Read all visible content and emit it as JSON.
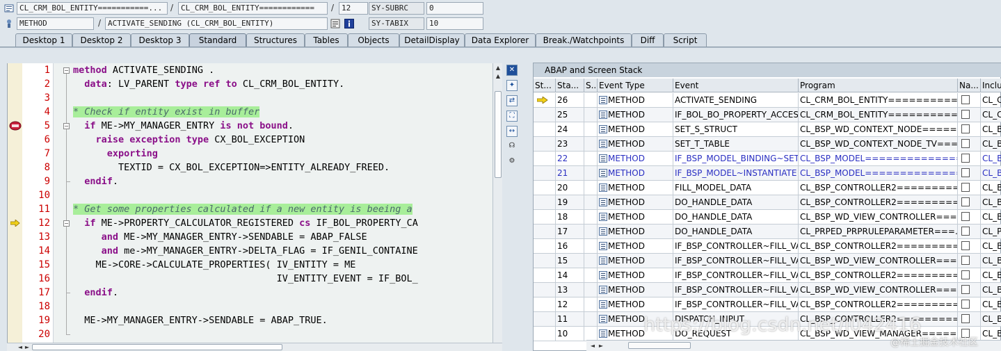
{
  "header": {
    "row1": {
      "class_field": "CL_CRM_BOL_ENTITY===========...",
      "class_field2": "CL_CRM_BOL_ENTITY============",
      "line": "12",
      "sysvar": "SY-SUBRC",
      "sysval": "0"
    },
    "row2": {
      "type_field": "METHOD",
      "name_field": "ACTIVATE_SENDING (CL_CRM_BOL_ENTITY)",
      "sysvar": "SY-TABIX",
      "sysval": "10"
    }
  },
  "tabs": [
    "Desktop 1",
    "Desktop 2",
    "Desktop 3",
    "Standard",
    "Structures",
    "Tables",
    "Objects",
    "DetailDisplay",
    "Data Explorer",
    "Break./Watchpoints",
    "Diff",
    "Script"
  ],
  "active_tab": "Standard",
  "editor": {
    "lines": [
      {
        "n": "1",
        "code": "method ACTIVATE_SENDING ."
      },
      {
        "n": "2",
        "code": "  data: LV_PARENT type ref to CL_CRM_BOL_ENTITY."
      },
      {
        "n": "3",
        "code": ""
      },
      {
        "n": "4",
        "code": "* Check if entity exist in buffer"
      },
      {
        "n": "5",
        "code": "  if ME->MY_MANAGER_ENTRY is not bound."
      },
      {
        "n": "6",
        "code": "    raise exception type CX_BOL_EXCEPTION"
      },
      {
        "n": "7",
        "code": "      exporting"
      },
      {
        "n": "8",
        "code": "        TEXTID = CX_BOL_EXCEPTION=>ENTITY_ALREADY_FREED."
      },
      {
        "n": "9",
        "code": "  endif."
      },
      {
        "n": "10",
        "code": ""
      },
      {
        "n": "11",
        "code": "* Get some properties calculated if a new entity is beeing a"
      },
      {
        "n": "12",
        "code": "  if ME->PROPERTY_CALCULATOR_REGISTERED cs IF_BOL_PROPERTY_CA"
      },
      {
        "n": "13",
        "code": "     and ME->MY_MANAGER_ENTRY->SENDABLE = ABAP_FALSE"
      },
      {
        "n": "14",
        "code": "     and me->MY_MANAGER_ENTRY->DELTA_FLAG = IF_GENIL_CONTAINE"
      },
      {
        "n": "15",
        "code": "    ME->CORE->CALCULATE_PROPERTIES( IV_ENTITY = ME"
      },
      {
        "n": "16",
        "code": "                                    IV_ENTITY_EVENT = IF_BOL_"
      },
      {
        "n": "17",
        "code": "  endif."
      },
      {
        "n": "18",
        "code": ""
      },
      {
        "n": "19",
        "code": "  ME->MY_MANAGER_ENTRY->SENDABLE = ABAP_TRUE."
      },
      {
        "n": "20",
        "code": ""
      }
    ]
  },
  "stack": {
    "title": "ABAP and Screen Stack",
    "columns": [
      "St...",
      "Sta...",
      "S...",
      "Event Type",
      "Event",
      "Program",
      "Na...",
      "Inclu"
    ],
    "rows": [
      {
        "level": "26",
        "type": "METHOD",
        "event": "ACTIVATE_SENDING",
        "program": "CL_CRM_BOL_ENTITY===========...",
        "incl": "CL_C"
      },
      {
        "level": "25",
        "type": "METHOD",
        "event": "IF_BOL_BO_PROPERTY_ACCES...",
        "program": "CL_CRM_BOL_ENTITY===========...",
        "incl": "CL_C"
      },
      {
        "level": "24",
        "type": "METHOD",
        "event": "SET_S_STRUCT",
        "program": "CL_BSP_WD_CONTEXT_NODE=====...",
        "incl": "CL_B"
      },
      {
        "level": "23",
        "type": "METHOD",
        "event": "SET_T_TABLE",
        "program": "CL_BSP_WD_CONTEXT_NODE_TV===...",
        "incl": "CL_B"
      },
      {
        "level": "22",
        "type": "METHOD",
        "event": "IF_BSP_MODEL_BINDING~SET...",
        "program": "CL_BSP_MODEL===============...",
        "incl": "CL_B"
      },
      {
        "level": "21",
        "type": "METHOD",
        "event": "IF_BSP_MODEL~INSTANTIATE",
        "program": "CL_BSP_MODEL===============...",
        "incl": "CL_B"
      },
      {
        "level": "20",
        "type": "METHOD",
        "event": "FILL_MODEL_DATA",
        "program": "CL_BSP_CONTROLLER2==========...",
        "incl": "CL_B"
      },
      {
        "level": "19",
        "type": "METHOD",
        "event": "DO_HANDLE_DATA",
        "program": "CL_BSP_CONTROLLER2==========...",
        "incl": "CL_B"
      },
      {
        "level": "18",
        "type": "METHOD",
        "event": "DO_HANDLE_DATA",
        "program": "CL_BSP_WD_VIEW_CONTROLLER===...",
        "incl": "CL_B"
      },
      {
        "level": "17",
        "type": "METHOD",
        "event": "DO_HANDLE_DATA",
        "program": "CL_PRPED_PRPRULEPARAMETER===...",
        "incl": "CL_P"
      },
      {
        "level": "16",
        "type": "METHOD",
        "event": "IF_BSP_CONTROLLER~FILL_VA...",
        "program": "CL_BSP_CONTROLLER2==========...",
        "incl": "CL_B"
      },
      {
        "level": "15",
        "type": "METHOD",
        "event": "IF_BSP_CONTROLLER~FILL_VA...",
        "program": "CL_BSP_WD_VIEW_CONTROLLER===...",
        "incl": "CL_B"
      },
      {
        "level": "14",
        "type": "METHOD",
        "event": "IF_BSP_CONTROLLER~FILL_VA...",
        "program": "CL_BSP_CONTROLLER2==========...",
        "incl": "CL_B"
      },
      {
        "level": "13",
        "type": "METHOD",
        "event": "IF_BSP_CONTROLLER~FILL_VA...",
        "program": "CL_BSP_WD_VIEW_CONTROLLER===...",
        "incl": "CL_B"
      },
      {
        "level": "12",
        "type": "METHOD",
        "event": "IF_BSP_CONTROLLER~FILL_VA...",
        "program": "CL_BSP_CONTROLLER2==========...",
        "incl": "CL_B"
      },
      {
        "level": "11",
        "type": "METHOD",
        "event": "DISPATCH_INPUT",
        "program": "CL_BSP_CONTROLLER2==========...",
        "incl": "CL_B"
      },
      {
        "level": "10",
        "type": "METHOD",
        "event": "DO_REQUEST",
        "program": "CL_BSP_WD_VIEW_MANAGER======...",
        "incl": "CL_B"
      }
    ]
  },
  "watermark": {
    "url": "https://blog.csdn.net/i042416",
    "site": "@稀土掘金技术社区"
  },
  "colors": {
    "keyword": "#8a0f88",
    "comment_bg": "#a8ee9a",
    "line_number": "#cc0000",
    "selected_row": "#2a2fc2"
  }
}
